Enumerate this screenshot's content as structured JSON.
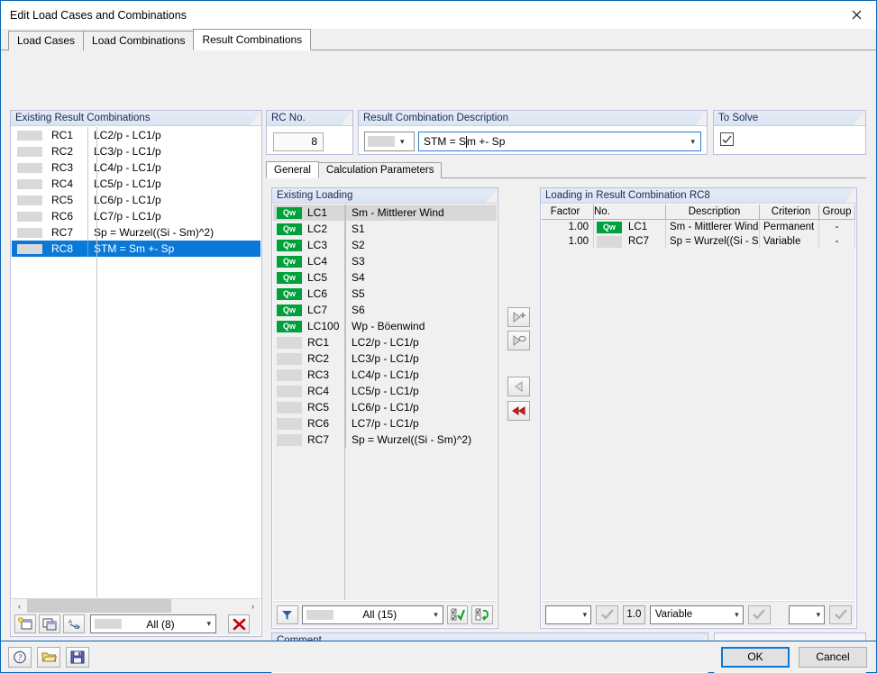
{
  "window": {
    "title": "Edit Load Cases and Combinations",
    "close_icon": "close-icon"
  },
  "tabs": [
    {
      "label": "Load Cases",
      "active": false
    },
    {
      "label": "Load Combinations",
      "active": false
    },
    {
      "label": "Result Combinations",
      "active": true
    }
  ],
  "existing_rc": {
    "header": "Existing Result Combinations",
    "rows": [
      {
        "no": "RC1",
        "desc": "LC2/p - LC1/p",
        "selected": false
      },
      {
        "no": "RC2",
        "desc": "LC3/p - LC1/p",
        "selected": false
      },
      {
        "no": "RC3",
        "desc": "LC4/p - LC1/p",
        "selected": false
      },
      {
        "no": "RC4",
        "desc": "LC5/p - LC1/p",
        "selected": false
      },
      {
        "no": "RC5",
        "desc": "LC6/p - LC1/p",
        "selected": false
      },
      {
        "no": "RC6",
        "desc": "LC7/p - LC1/p",
        "selected": false
      },
      {
        "no": "RC7",
        "desc": "Sp = Wurzel((Si - Sm)^2)",
        "selected": false
      },
      {
        "no": "RC8",
        "desc": "STM = Sm +- Sp",
        "selected": true
      }
    ],
    "toolbar": {
      "new_icon": "new-combination-icon",
      "copy_icon": "copy-combination-icon",
      "renumber_icon": "renumber-icon",
      "filter_value": "All (8)",
      "delete_icon": "delete-red-x-icon"
    },
    "scroll": {
      "left_arrow": "‹",
      "right_arrow": "›"
    }
  },
  "rc_no": {
    "header": "RC No.",
    "value": "8"
  },
  "rc_description": {
    "header": "Result Combination Description",
    "color_swatch": "color-swatch",
    "text_before_caret": "STM = S",
    "text_after_caret": "m +- Sp",
    "dropdown_icon": "chevron-down-icon"
  },
  "to_solve": {
    "header": "To Solve",
    "checked": true,
    "check_icon": "check-icon"
  },
  "inner_tabs": [
    {
      "label": "General",
      "active": true
    },
    {
      "label": "Calculation Parameters",
      "active": false
    }
  ],
  "existing_loading": {
    "header": "Existing Loading",
    "rows": [
      {
        "badge": "Qw",
        "type": "lc",
        "no": "LC1",
        "desc": "Sm - Mittlerer Wind",
        "highlight": true
      },
      {
        "badge": "Qw",
        "type": "lc",
        "no": "LC2",
        "desc": "S1",
        "highlight": false
      },
      {
        "badge": "Qw",
        "type": "lc",
        "no": "LC3",
        "desc": "S2",
        "highlight": false
      },
      {
        "badge": "Qw",
        "type": "lc",
        "no": "LC4",
        "desc": "S3",
        "highlight": false
      },
      {
        "badge": "Qw",
        "type": "lc",
        "no": "LC5",
        "desc": "S4",
        "highlight": false
      },
      {
        "badge": "Qw",
        "type": "lc",
        "no": "LC6",
        "desc": "S5",
        "highlight": false
      },
      {
        "badge": "Qw",
        "type": "lc",
        "no": "LC7",
        "desc": "S6",
        "highlight": false
      },
      {
        "badge": "Qw",
        "type": "lc",
        "no": "LC100",
        "desc": "Wp - Böenwind",
        "highlight": false
      },
      {
        "badge": "",
        "type": "rc",
        "no": "RC1",
        "desc": "LC2/p - LC1/p",
        "highlight": false
      },
      {
        "badge": "",
        "type": "rc",
        "no": "RC2",
        "desc": "LC3/p - LC1/p",
        "highlight": false
      },
      {
        "badge": "",
        "type": "rc",
        "no": "RC3",
        "desc": "LC4/p - LC1/p",
        "highlight": false
      },
      {
        "badge": "",
        "type": "rc",
        "no": "RC4",
        "desc": "LC5/p - LC1/p",
        "highlight": false
      },
      {
        "badge": "",
        "type": "rc",
        "no": "RC5",
        "desc": "LC6/p - LC1/p",
        "highlight": false
      },
      {
        "badge": "",
        "type": "rc",
        "no": "RC6",
        "desc": "LC7/p - LC1/p",
        "highlight": false
      },
      {
        "badge": "",
        "type": "rc",
        "no": "RC7",
        "desc": "Sp = Wurzel((Si - Sm)^2)",
        "highlight": false
      }
    ],
    "toolbar": {
      "filter_icon": "funnel-filter-icon",
      "filter_value": "All (15)",
      "select_all_icon": "select-all-check-icon",
      "invert_selection_icon": "invert-selection-icon"
    }
  },
  "transfer_buttons": [
    {
      "name": "add-to-combination-button",
      "icon": "arrow-right-plus-icon",
      "enabled": false
    },
    {
      "name": "add-with-reference-button",
      "icon": "arrow-right-link-icon",
      "enabled": false
    },
    {
      "name": "remove-from-combination-button",
      "icon": "arrow-left-icon",
      "enabled": false
    },
    {
      "name": "remove-all-button",
      "icon": "double-arrow-left-red-icon",
      "enabled": true
    }
  ],
  "rc_loading": {
    "header": "Loading in Result Combination RC8",
    "columns": [
      "Factor",
      "No.",
      "Description",
      "Criterion",
      "Group"
    ],
    "rows": [
      {
        "factor": "1.00",
        "badge": "Qw",
        "type": "lc",
        "no": "LC1",
        "desc": "Sm - Mittlerer Wind",
        "criterion": "Permanent",
        "group": "-"
      },
      {
        "factor": "1.00",
        "badge": "",
        "type": "rc",
        "no": "RC7",
        "desc": "Sp = Wurzel((Si - S",
        "criterion": "Variable",
        "group": "-"
      }
    ],
    "toolbar": {
      "operator_value": "",
      "operator_confirm_icon": "check-icon",
      "factor_value": "1.0",
      "criterion_value": "Variable",
      "criterion_confirm_icon": "check-icon",
      "group_value": "",
      "group_confirm_icon": "check-icon"
    }
  },
  "comment": {
    "header": "Comment",
    "value": "",
    "dropdown_icon": "chevron-down-icon",
    "pick_button_icon": "comment-library-icon"
  },
  "right_bottom_panel": {
    "render_icon": "render-view-icon",
    "details_icon": "details-magnifier-icon"
  },
  "bottom_bar": {
    "help_icon": "help-question-icon",
    "open_icon": "open-folder-icon",
    "save_icon": "save-floppy-icon",
    "ok_label": "OK",
    "cancel_label": "Cancel"
  },
  "colors": {
    "accent_blue": "#0a78d7",
    "badge_green": "#00a03c",
    "panel_border": "#b9bede",
    "header_gradient_top": "#e5ecf6",
    "delete_red": "#cc0000"
  }
}
